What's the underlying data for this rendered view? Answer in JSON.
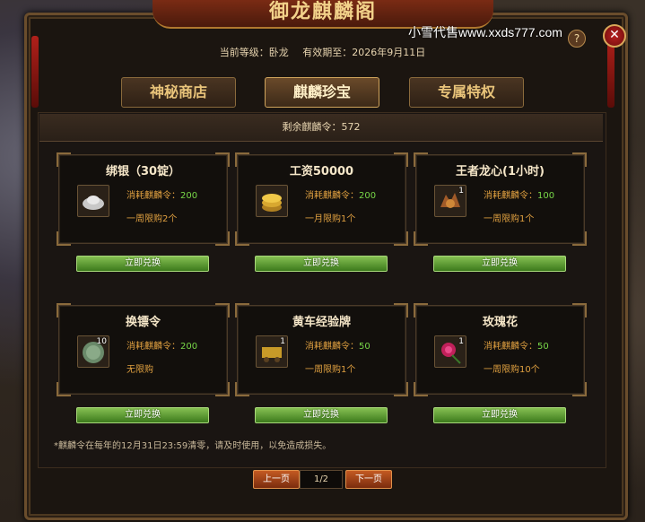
{
  "window": {
    "title": "御龙麒麟阁",
    "watermark": "小雪代售www.xxds777.com",
    "help_label": "?",
    "close_label": "✕"
  },
  "header": {
    "level_label": "当前等级：卧龙",
    "valid_label": "有效期至：2026年9月11日"
  },
  "tabs": [
    {
      "label": "神秘商店",
      "active": false
    },
    {
      "label": "麒麟珍宝",
      "active": true
    },
    {
      "label": "专属特权",
      "active": false
    }
  ],
  "remaining": "剩余麒麟令：572",
  "items": [
    {
      "name": "绑银（30锭）",
      "icon": "silver-ingot-icon",
      "qty": "",
      "cost_label": "消耗麒麟令：",
      "cost": "200",
      "limit": "一周限购2个",
      "button": "立即兑换"
    },
    {
      "name": "工资50000",
      "icon": "gold-coins-icon",
      "qty": "",
      "cost_label": "消耗麒麟令：",
      "cost": "200",
      "limit": "一月限购1个",
      "button": "立即兑换"
    },
    {
      "name": "王者龙心(1小时)",
      "icon": "dragon-heart-icon",
      "qty": "1",
      "cost_label": "消耗麒麟令：",
      "cost": "100",
      "limit": "一周限购1个",
      "button": "立即兑换"
    },
    {
      "name": "换镖令",
      "icon": "escort-token-icon",
      "qty": "10",
      "cost_label": "消耗麒麟令：",
      "cost": "200",
      "limit": "无限购",
      "button": "立即兑换"
    },
    {
      "name": "黄车经验牌",
      "icon": "yellow-cart-icon",
      "qty": "1",
      "cost_label": "消耗麒麟令：",
      "cost": "50",
      "limit": "一周限购1个",
      "button": "立即兑换"
    },
    {
      "name": "玫瑰花",
      "icon": "rose-icon",
      "qty": "1",
      "cost_label": "消耗麒麟令：",
      "cost": "50",
      "limit": "一周限购10个",
      "button": "立即兑换"
    }
  ],
  "note": "*麒麟令在每年的12月31日23:59清零，请及时使用，以免造成损失。",
  "pagination": {
    "prev": "上一页",
    "page": "1/2",
    "next": "下一页"
  }
}
